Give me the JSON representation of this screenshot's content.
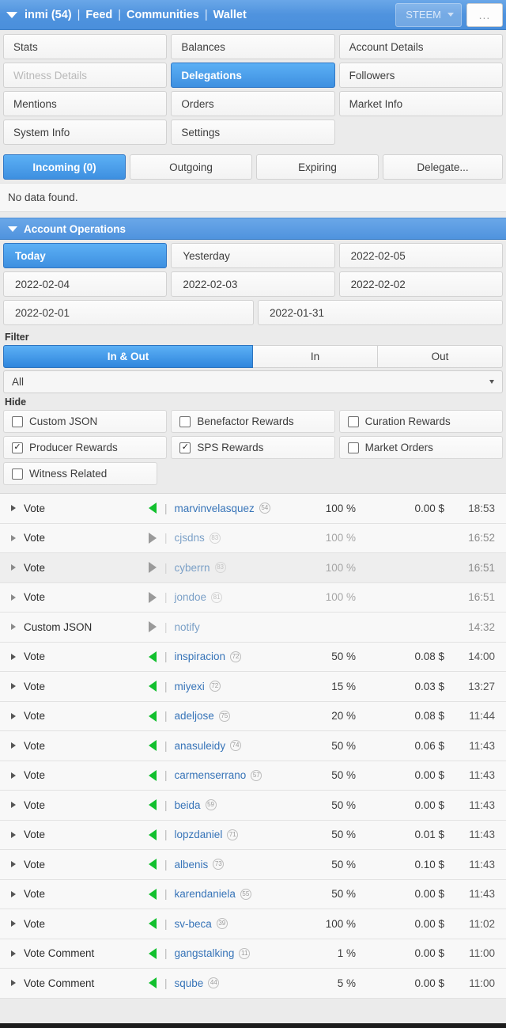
{
  "topbar": {
    "caret": "caret-down-icon",
    "account": "inmi (54)",
    "separator": "|",
    "links": [
      "Feed",
      "Communities",
      "Wallet"
    ],
    "token_selector": "STEEM",
    "overflow_label": "..."
  },
  "section_tabs": [
    [
      {
        "label": "Stats",
        "state": "normal"
      },
      {
        "label": "Balances",
        "state": "normal"
      },
      {
        "label": "Account Details",
        "state": "normal"
      }
    ],
    [
      {
        "label": "Witness Details",
        "state": "disabled"
      },
      {
        "label": "Delegations",
        "state": "active"
      },
      {
        "label": "Followers",
        "state": "normal"
      }
    ],
    [
      {
        "label": "Mentions",
        "state": "normal"
      },
      {
        "label": "Orders",
        "state": "normal"
      },
      {
        "label": "Market Info",
        "state": "normal"
      }
    ],
    [
      {
        "label": "System Info",
        "state": "normal"
      },
      {
        "label": "Settings",
        "state": "normal"
      },
      {
        "label": "",
        "state": "empty"
      }
    ]
  ],
  "delegation": {
    "tabs": [
      {
        "label": "Incoming (0)",
        "state": "active"
      },
      {
        "label": "Outgoing",
        "state": "normal"
      },
      {
        "label": "Expiring",
        "state": "normal"
      },
      {
        "label": "Delegate...",
        "state": "normal"
      }
    ],
    "empty_message": "No data found."
  },
  "account_operations": {
    "title": "Account Operations",
    "caret": "caret-down-icon",
    "date_buttons": [
      [
        {
          "label": "Today",
          "state": "active"
        },
        {
          "label": "Yesterday",
          "state": "normal"
        },
        {
          "label": "2022-02-05",
          "state": "normal"
        }
      ],
      [
        {
          "label": "2022-02-04",
          "state": "normal"
        },
        {
          "label": "2022-02-03",
          "state": "normal"
        },
        {
          "label": "2022-02-02",
          "state": "normal"
        }
      ],
      [
        {
          "label": "2022-02-01",
          "state": "normal"
        },
        {
          "label": "2022-01-31",
          "state": "normal"
        }
      ]
    ]
  },
  "filter": {
    "label": "Filter",
    "direction_options": [
      {
        "label": "In & Out",
        "state": "active"
      },
      {
        "label": "In",
        "state": "normal"
      },
      {
        "label": "Out",
        "state": "normal"
      }
    ],
    "type_select": {
      "value": "All",
      "caret": "caret-down-icon"
    }
  },
  "hide": {
    "label": "Hide",
    "rows": [
      [
        {
          "label": "Custom JSON",
          "checked": false
        },
        {
          "label": "Benefactor Rewards",
          "checked": false
        },
        {
          "label": "Curation Rewards",
          "checked": false
        }
      ],
      [
        {
          "label": "Producer Rewards",
          "checked": true
        },
        {
          "label": "SPS Rewards",
          "checked": true
        },
        {
          "label": "Market Orders",
          "checked": false
        }
      ],
      [
        {
          "label": "Witness Related",
          "checked": false
        }
      ]
    ],
    "check_glyph": "✓"
  },
  "operations": {
    "pipe": "|",
    "rows": [
      {
        "type": "Vote",
        "direction": "in",
        "user": "marvinvelasquez",
        "rep": "54",
        "percent": "100 %",
        "value": "0.00 $",
        "time": "18:53",
        "dim": false,
        "alt": false
      },
      {
        "type": "Vote",
        "direction": "out",
        "user": "cjsdns",
        "rep": "83",
        "percent": "100 %",
        "value": "",
        "time": "16:52",
        "dim": true,
        "alt": false
      },
      {
        "type": "Vote",
        "direction": "out",
        "user": "cyberrn",
        "rep": "83",
        "percent": "100 %",
        "value": "",
        "time": "16:51",
        "dim": true,
        "alt": true
      },
      {
        "type": "Vote",
        "direction": "out",
        "user": "jondoe",
        "rep": "81",
        "percent": "100 %",
        "value": "",
        "time": "16:51",
        "dim": true,
        "alt": false
      },
      {
        "type": "Custom JSON",
        "direction": "out",
        "user": "notify",
        "rep": "",
        "percent": "",
        "value": "",
        "time": "14:32",
        "dim": true,
        "alt": false
      },
      {
        "type": "Vote",
        "direction": "in",
        "user": "inspiracion",
        "rep": "72",
        "percent": "50 %",
        "value": "0.08 $",
        "time": "14:00",
        "dim": false,
        "alt": false
      },
      {
        "type": "Vote",
        "direction": "in",
        "user": "miyexi",
        "rep": "72",
        "percent": "15 %",
        "value": "0.03 $",
        "time": "13:27",
        "dim": false,
        "alt": false
      },
      {
        "type": "Vote",
        "direction": "in",
        "user": "adeljose",
        "rep": "75",
        "percent": "20 %",
        "value": "0.08 $",
        "time": "11:44",
        "dim": false,
        "alt": false
      },
      {
        "type": "Vote",
        "direction": "in",
        "user": "anasuleidy",
        "rep": "74",
        "percent": "50 %",
        "value": "0.06 $",
        "time": "11:43",
        "dim": false,
        "alt": false
      },
      {
        "type": "Vote",
        "direction": "in",
        "user": "carmenserrano",
        "rep": "57",
        "percent": "50 %",
        "value": "0.00 $",
        "time": "11:43",
        "dim": false,
        "alt": false
      },
      {
        "type": "Vote",
        "direction": "in",
        "user": "beida",
        "rep": "59",
        "percent": "50 %",
        "value": "0.00 $",
        "time": "11:43",
        "dim": false,
        "alt": false
      },
      {
        "type": "Vote",
        "direction": "in",
        "user": "lopzdaniel",
        "rep": "71",
        "percent": "50 %",
        "value": "0.01 $",
        "time": "11:43",
        "dim": false,
        "alt": false
      },
      {
        "type": "Vote",
        "direction": "in",
        "user": "albenis",
        "rep": "73",
        "percent": "50 %",
        "value": "0.10 $",
        "time": "11:43",
        "dim": false,
        "alt": false
      },
      {
        "type": "Vote",
        "direction": "in",
        "user": "karendaniela",
        "rep": "55",
        "percent": "50 %",
        "value": "0.00 $",
        "time": "11:43",
        "dim": false,
        "alt": false
      },
      {
        "type": "Vote",
        "direction": "in",
        "user": "sv-beca",
        "rep": "39",
        "percent": "100 %",
        "value": "0.00 $",
        "time": "11:02",
        "dim": false,
        "alt": false
      },
      {
        "type": "Vote Comment",
        "direction": "in",
        "user": "gangstalking",
        "rep": "11",
        "percent": "1 %",
        "value": "0.00 $",
        "time": "11:00",
        "dim": false,
        "alt": false
      },
      {
        "type": "Vote Comment",
        "direction": "in",
        "user": "sqube",
        "rep": "44",
        "percent": "5 %",
        "value": "0.00 $",
        "time": "11:00",
        "dim": false,
        "alt": false
      }
    ]
  },
  "colors": {
    "accent_blue": "#4f93de",
    "active_blue": "#3d8fe0",
    "link_blue": "#3774b8",
    "incoming_green": "#12c02e",
    "outgoing_grey": "#9a9a9a"
  }
}
